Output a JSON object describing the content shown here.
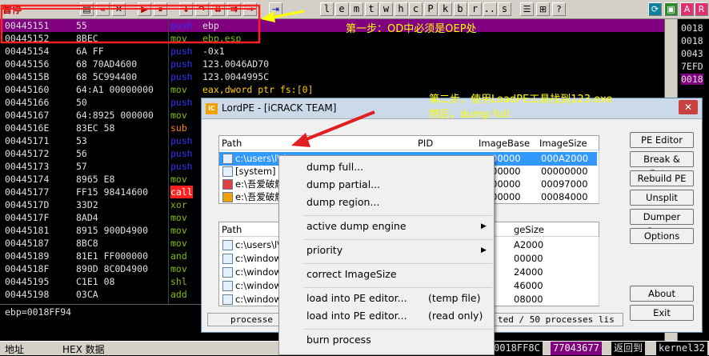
{
  "toolbar": {
    "status": "暂停",
    "buttons_mid": [
      "l",
      "e",
      "m",
      "t",
      "w",
      "h",
      "c",
      "P",
      "k",
      "b",
      "r",
      "...",
      "s"
    ]
  },
  "disasm": [
    {
      "addr": "00445151",
      "hex": "55",
      "mnem": "push",
      "ops": "ebp",
      "color": "blue",
      "sel": true
    },
    {
      "addr": "00445152",
      "hex": "8BEC",
      "mnem": "mov",
      "ops": "ebp,esp",
      "color": "green"
    },
    {
      "addr": "00445154",
      "hex": "6A FF",
      "mnem": "push",
      "ops": "-0x1",
      "color": "blue"
    },
    {
      "addr": "00445156",
      "hex": "68 70AD4600",
      "mnem": "push",
      "ops": "123.0046AD70",
      "color": "blue"
    },
    {
      "addr": "0044515B",
      "hex": "68 5C994400",
      "mnem": "push",
      "ops": "123.0044995C",
      "color": "blue"
    },
    {
      "addr": "00445160",
      "hex": "64:A1 00000000",
      "mnem": "mov",
      "ops": "eax,dword ptr fs:[0]",
      "color": "green"
    },
    {
      "addr": "00445166",
      "hex": "50",
      "mnem": "push",
      "ops": "",
      "color": "blue"
    },
    {
      "addr": "00445167",
      "hex": "64:8925 000000",
      "mnem": "mov",
      "ops": "",
      "color": "green"
    },
    {
      "addr": "0044516E",
      "hex": "83EC 58",
      "mnem": "sub",
      "ops": "",
      "color": "orange"
    },
    {
      "addr": "00445171",
      "hex": "53",
      "mnem": "push",
      "ops": "",
      "color": "blue"
    },
    {
      "addr": "00445172",
      "hex": "56",
      "mnem": "push",
      "ops": "",
      "color": "blue"
    },
    {
      "addr": "00445173",
      "hex": "57",
      "mnem": "push",
      "ops": "",
      "color": "blue"
    },
    {
      "addr": "00445174",
      "hex": "8965 E8",
      "mnem": "mov",
      "ops": "",
      "color": "green"
    },
    {
      "addr": "00445177",
      "hex": "FF15 98414600",
      "mnem": "call",
      "ops": "",
      "color": "red"
    },
    {
      "addr": "0044517D",
      "hex": "33D2",
      "mnem": "xor",
      "ops": "",
      "color": "green"
    },
    {
      "addr": "0044517F",
      "hex": "8AD4",
      "mnem": "mov",
      "ops": "",
      "color": "green"
    },
    {
      "addr": "00445181",
      "hex": "8915 900D4900",
      "mnem": "mov",
      "ops": "",
      "color": "green"
    },
    {
      "addr": "00445187",
      "hex": "8BC8",
      "mnem": "mov",
      "ops": "",
      "color": "green"
    },
    {
      "addr": "00445189",
      "hex": "81E1 FF000000",
      "mnem": "and",
      "ops": "",
      "color": "green"
    },
    {
      "addr": "0044518F",
      "hex": "890D 8C0D4900",
      "mnem": "mov",
      "ops": "",
      "color": "green"
    },
    {
      "addr": "00445195",
      "hex": "C1E1 08",
      "mnem": "shl",
      "ops": "",
      "color": "green"
    },
    {
      "addr": "00445198",
      "hex": "03CA",
      "mnem": "add",
      "ops": "",
      "color": "green"
    }
  ],
  "info_line": "ebp=0018FF94",
  "reg_values": [
    "0018 (",
    "0018",
    "0043",
    "7EFD",
    "0018"
  ],
  "statusbar": {
    "addr_label": "地址",
    "hex_label": "HEX 数据",
    "stack_addr": "0018FF8C",
    "stack_val": "77043677",
    "return_text": "返回到",
    "module": "kernel32"
  },
  "notes": {
    "step1": "第一步：OD中必须是OEP处",
    "step2a": "第二步，使用LoadPE工具找到123.exe",
    "step2b": "然后，dump full"
  },
  "lordpe": {
    "title": "LordPE - [iCRACK TEAM]",
    "icon": "iC",
    "close": "✕",
    "proc_headers": {
      "path": "Path",
      "pid": "PID",
      "base": "ImageBase",
      "size": "ImageSize"
    },
    "processes": [
      {
        "path": "c:\\users\\l\\d",
        "base": "00000",
        "size": "000A2000",
        "sel": true
      },
      {
        "path": "[system]",
        "base": "00000",
        "size": "00000000"
      },
      {
        "path": "e:\\吾爱破解",
        "base": "00000",
        "size": "00097000"
      },
      {
        "path": "e:\\吾爱破解",
        "base": "00000",
        "size": "00084000"
      }
    ],
    "mod_headers": {
      "path": "Path",
      "size": "geSize"
    },
    "modules": [
      {
        "path": "c:\\users\\l\\d",
        "size": "A2000"
      },
      {
        "path": "c:\\windows",
        "size": "00000"
      },
      {
        "path": "c:\\windows",
        "size": "24000"
      },
      {
        "path": "c:\\windows",
        "size": "46000"
      },
      {
        "path": "c:\\windows",
        "size": "08000"
      }
    ],
    "buttons": [
      "PE Editor",
      "Break & Enter",
      "Rebuild PE",
      "Unsplit",
      "Dumper Server",
      "Options",
      "About",
      "Exit"
    ],
    "status_left": "processe",
    "status_right": "ted / 50 processes lis"
  },
  "context_menu": {
    "items": [
      "dump full...",
      "dump partial...",
      "dump region..."
    ],
    "engine": "active dump engine",
    "priority": "priority",
    "correct": "correct ImageSize",
    "load1": "load into PE editor...",
    "load1_tag": "(temp file)",
    "load2": "load into PE editor...",
    "load2_tag": "(read only)",
    "burn": "burn process"
  },
  "colors": {
    "annotation": "#ff2020",
    "note": "#ffff00",
    "selection": "#800080"
  }
}
